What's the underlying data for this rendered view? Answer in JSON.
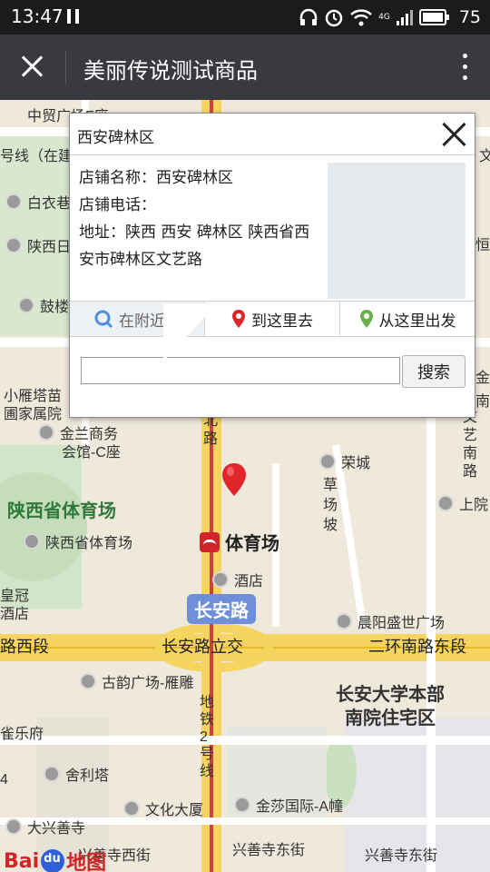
{
  "status_bar": {
    "time": "13:47",
    "battery": "75",
    "network": "4G"
  },
  "app_bar": {
    "title": "美丽传说测试商品"
  },
  "popup": {
    "title": "西安碑林区",
    "store_name": "店铺名称：西安碑林区",
    "store_phone": "店铺电话：",
    "address": "地址：陕西 西安 碑林区 陕西省西安市碑林区文艺路",
    "tabs": [
      "在附近找",
      "到这里去",
      "从这里出发"
    ],
    "search_placeholder": "",
    "search_button": "搜索"
  },
  "map": {
    "labels": {
      "zhongmao": "中贸广场F座",
      "line5": "号线（在建",
      "baiyi": "白衣巷",
      "shaanxi_xi": "陕西日",
      "guju": "鼓楼",
      "xiaoyanta": "小雁塔苗",
      "huajia": "圃家属院",
      "jinlan": "金兰商务",
      "jinlan2": "会馆-C座",
      "stadium_big": "陕西省体育场",
      "stadium_poi": "陕西省体育场",
      "huangguan": "皇冠",
      "jiudian": "酒店",
      "jiudian2": "酒店",
      "lu_west": "路西段",
      "changan_lijiao": "长安路立交",
      "erhuan_east": "二环南路东段",
      "guyun": "古韵广场-雁雕",
      "changan_univ": "长安大学本部",
      "changan_univ2": "南院住宅区",
      "yuanfu": "雀乐府",
      "shelita": "舍利塔",
      "wenhua": "文化大厦",
      "jinsha": "金莎国际-A幢",
      "daxingshan": "大兴善寺",
      "xingshan_west": "兴善寺西街",
      "xingshan_east": "兴善寺东街",
      "xingshan_east2": "兴善寺东街",
      "rongcheng": "荣城",
      "caochang": "草\n场\n坡",
      "shangyuan": "上院",
      "chenyang": "晨阳盛世广场",
      "metro_line2": "地\n铁\n2\n号\n线",
      "wenyi_south": "文\n艺\n南\n路",
      "beilu": "北\n路",
      "heng": "恒",
      "jin": "金",
      "nan": "南",
      "wen": "文",
      "num4": "4"
    },
    "metro_station": "体育场",
    "road_badge": "长安路",
    "logo_text1": "Bai",
    "logo_text2": "地图"
  }
}
